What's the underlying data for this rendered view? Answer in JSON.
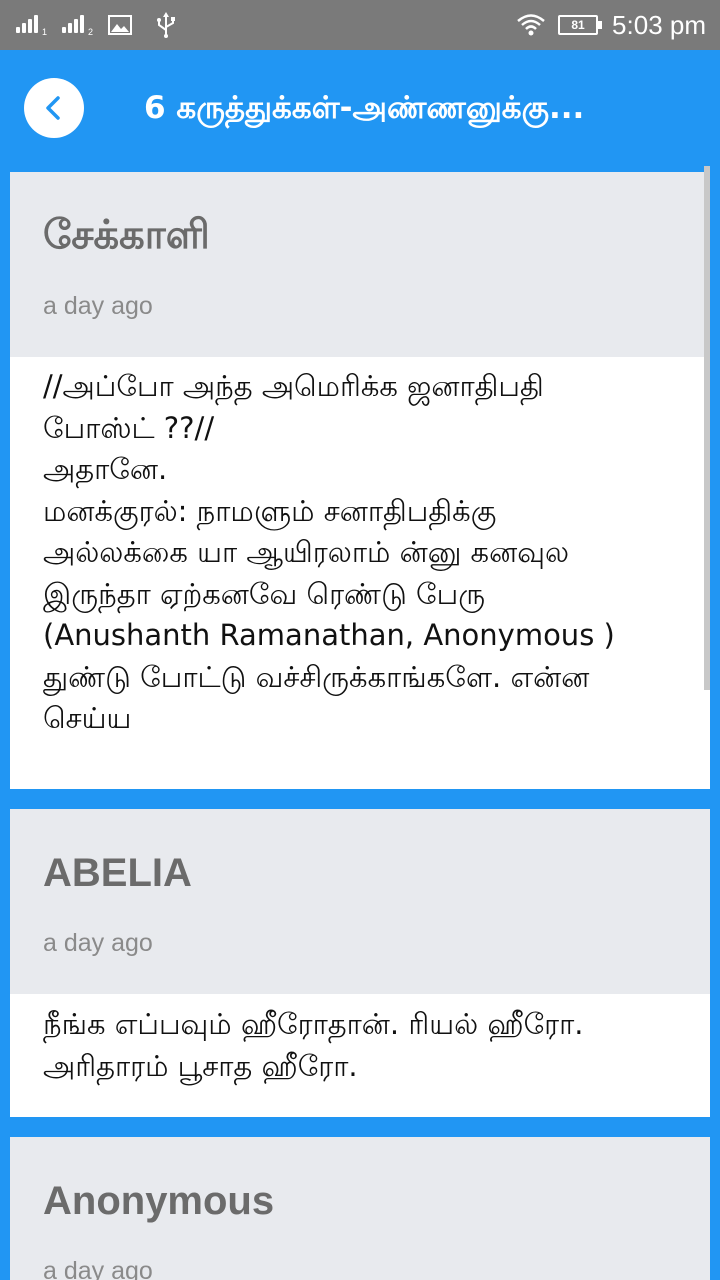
{
  "status_bar": {
    "signal1_sub": "1",
    "signal2_sub": "2",
    "battery_level": "81",
    "time": "5:03 pm",
    "icons": [
      "signal-icon",
      "signal-icon",
      "gallery-icon",
      "usb-icon",
      "wifi-icon",
      "battery-icon"
    ]
  },
  "app_bar": {
    "title": "6 கருத்துக்கள்-அண்ணனுக்கு...",
    "back_icon": "chevron-left-icon",
    "accent_color": "#2196f3"
  },
  "comments": [
    {
      "author": "சேக்காளி",
      "time": "a day ago",
      "text": "//அப்போ அந்த அமெரிக்க ஜனாதிபதி\nபோஸ்ட் ??//\nஅதானே.\nமனக்குரல்: நாமளும் சனாதிபதிக்கு\nஅல்லக்கை யா ஆயிரலாம் ன்னு கனவுல\nஇருந்தா ஏற்கனவே ரெண்டு பேரு\n(Anushanth Ramanathan, Anonymous )\nதுண்டு போட்டு வச்சிருக்காங்களே. என்ன\nசெய்ய"
    },
    {
      "author": "ABELIA",
      "time": "a day ago",
      "text": "நீங்க எப்பவும் ஹீரோதான். ரியல் ஹீரோ.\nஅரிதாரம் பூசாத ஹீரோ."
    },
    {
      "author": "Anonymous",
      "time": "a day ago",
      "text": ""
    }
  ]
}
